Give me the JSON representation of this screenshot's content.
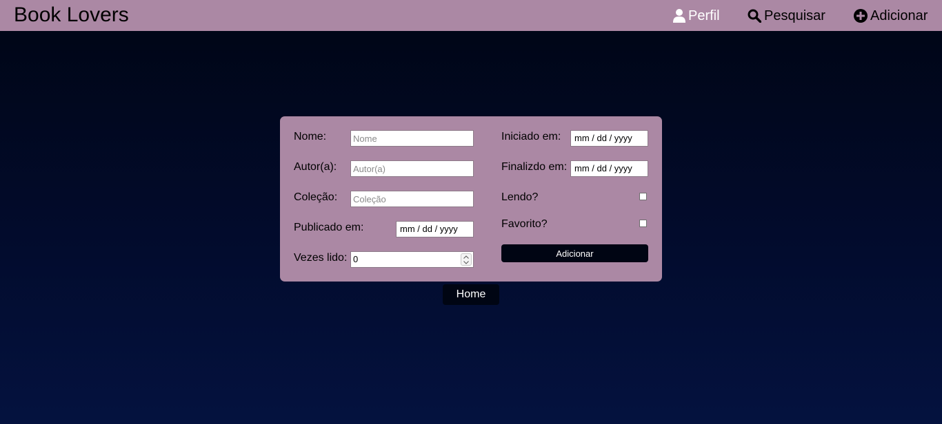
{
  "navbar": {
    "brand": "Book Lovers",
    "links": [
      {
        "label": "Perfil",
        "icon": "user-icon"
      },
      {
        "label": "Pesquisar",
        "icon": "search-icon"
      },
      {
        "label": "Adicionar",
        "icon": "plus-circle-icon"
      }
    ]
  },
  "form": {
    "nome": {
      "label": "Nome:",
      "placeholder": "Nome",
      "value": ""
    },
    "autor": {
      "label": "Autor(a):",
      "placeholder": "Autor(a)",
      "value": ""
    },
    "colecao": {
      "label": "Coleção:",
      "placeholder": "Coleção",
      "value": ""
    },
    "publicado": {
      "label": "Publicado em:",
      "value": "mm / dd / yyyy"
    },
    "vezes": {
      "label": "Vezes lido:",
      "value": "0"
    },
    "iniciado": {
      "label": "Iniciado em:",
      "value": "mm / dd / yyyy"
    },
    "finalizado": {
      "label": "Finalizdo em:",
      "value": "mm / dd / yyyy"
    },
    "lendo": {
      "label": "Lendo?",
      "checked": false
    },
    "favorito": {
      "label": "Favorito?",
      "checked": false
    },
    "submit_label": "Adicionar"
  },
  "home_label": "Home",
  "colors": {
    "navbar": "#ab88a4",
    "card": "#ab88a4",
    "button": "#000513",
    "background_top": "#000514",
    "background_bottom": "#04123f"
  }
}
